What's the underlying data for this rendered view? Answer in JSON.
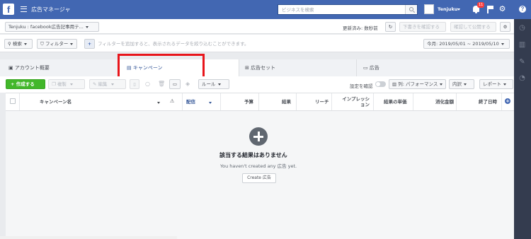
{
  "topbar": {
    "title": "広告マネージャ",
    "search_placeholder": "ビジネスを検索",
    "account_name": "Tenjuku",
    "notification_count": "11"
  },
  "toolbar": {
    "account_selector": "Tenjuku : facebook広告記事用テ...",
    "updated_label": "更新済み: 数秒前",
    "review_drafts": "下書きを確認する",
    "review_publish": "確認して公開する"
  },
  "filter_bar": {
    "search_button": "検索",
    "filter_button": "フィルター",
    "filter_placeholder": "フィルターを追加すると、表示されるデータを絞り込むことができます。",
    "date_range": "今月: 2019/05/01 ~ 2019/05/10"
  },
  "tabs": [
    {
      "label": "アカウント概要"
    },
    {
      "label": "キャンペーン"
    },
    {
      "label": "広告セット"
    },
    {
      "label": "広告"
    }
  ],
  "action_bar": {
    "create_button": "+ 作成する",
    "duplicate_button": "複製",
    "edit_button": "編集",
    "rules_button": "ルール",
    "setting_check": "設定を確認",
    "columns_button": "列: パフォーマンス",
    "breakdown_button": "内訳",
    "reports_button": "レポート"
  },
  "table": {
    "columns": [
      {
        "label": "キャンペーン名"
      },
      {
        "label": "配信"
      },
      {
        "label": "予算"
      },
      {
        "label": "結果"
      },
      {
        "label": "リーチ"
      },
      {
        "label": "インプレッション"
      },
      {
        "label": "結果の単価"
      },
      {
        "label": "消化金額"
      },
      {
        "label": "終了日時"
      }
    ]
  },
  "empty_state": {
    "title": "該当する結果はありません",
    "subtitle": "You haven't created any 広告 yet.",
    "button": "Create 広告"
  },
  "colors": {
    "topbar": "#4267b2",
    "create_button": "#42b72a",
    "highlight_box": "#e8151b",
    "right_rail": "#343c4f"
  },
  "icons": [
    "facebook-logo-icon",
    "menu-icon",
    "search-icon",
    "bell-icon",
    "flag-icon",
    "gear-icon",
    "help-icon",
    "refresh-icon",
    "plus-icon"
  ]
}
